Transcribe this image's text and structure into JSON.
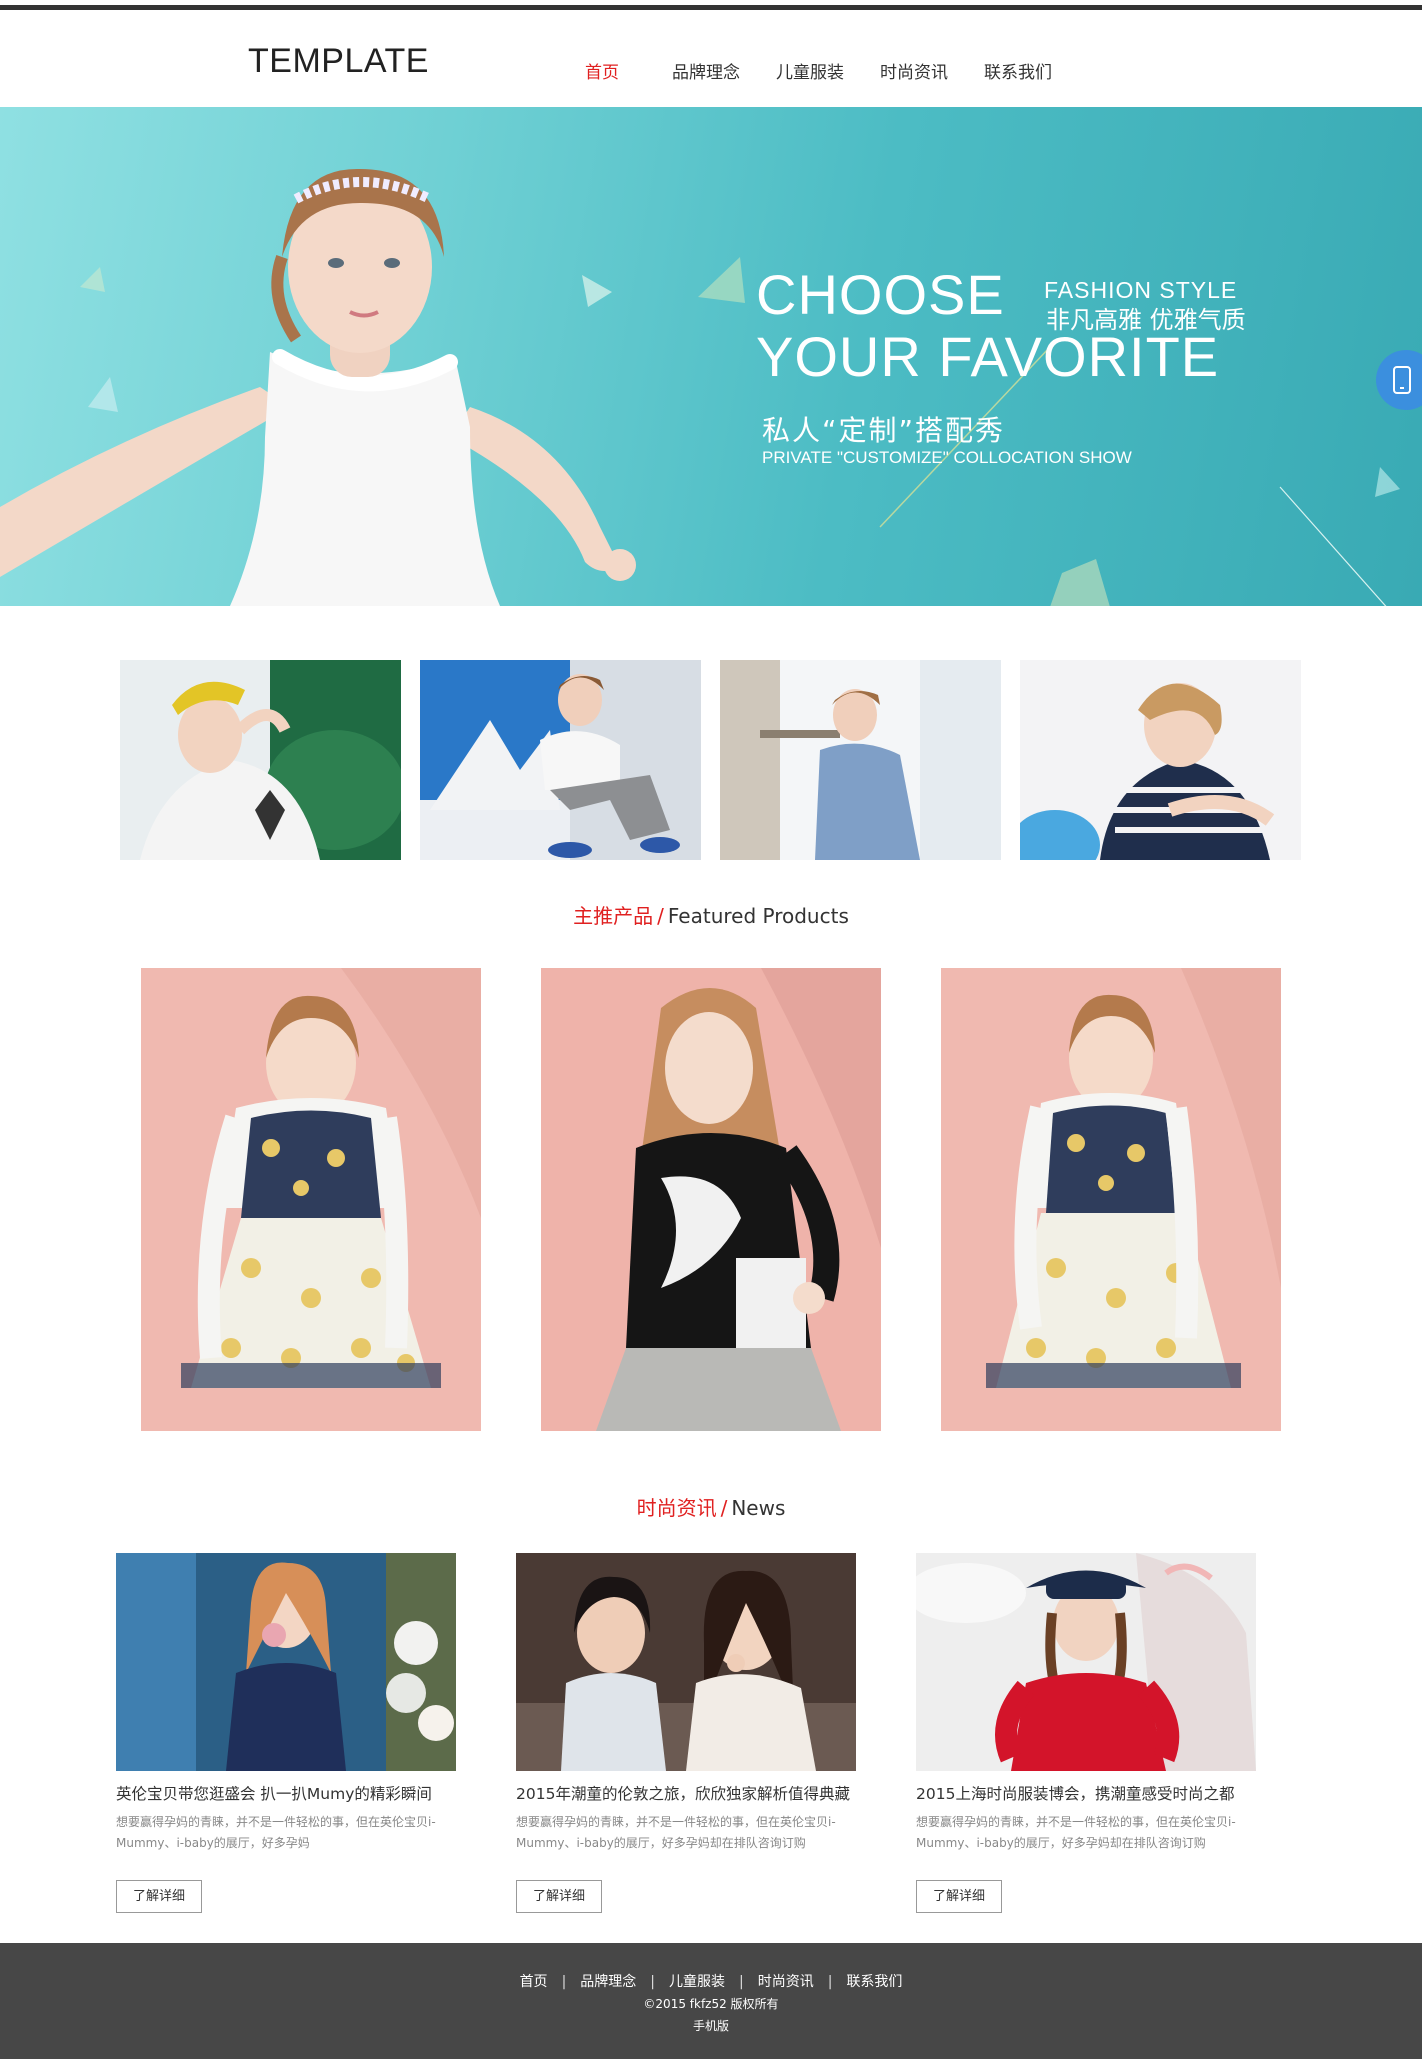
{
  "header": {
    "logo": "TEMPLATE",
    "nav": [
      {
        "label": "首页",
        "active": true
      },
      {
        "label": "品牌理念",
        "active": false
      },
      {
        "label": "儿童服装",
        "active": false
      },
      {
        "label": "时尚资讯",
        "active": false
      },
      {
        "label": "联系我们",
        "active": false
      }
    ]
  },
  "banner": {
    "line1": "CHOOSE",
    "line2": "YOUR FAVORITE",
    "fashion_style": "FASHION STYLE",
    "fashion_style_cn": "非凡高雅 优雅气质",
    "tagline_cn": "私人“定制”搭配秀",
    "tagline_en": "PRIVATE \"CUSTOMIZE\" COLLOCATION SHOW"
  },
  "side_tab": {
    "icon": "mobile-phone-icon"
  },
  "featured": {
    "title_cn": "主推产品",
    "slash": "/",
    "title_en": "Featured Products"
  },
  "news": {
    "title_cn": "时尚资讯",
    "slash": "/",
    "title_en": "News",
    "items": [
      {
        "title": "英伦宝贝带您逛盛会 扒一扒Mumy的精彩瞬间",
        "desc": "想要赢得孕妈的青睐，并不是一件轻松的事，但在英伦宝贝i-Mummy、i-baby的展厅，好多孕妈",
        "button": "了解详细"
      },
      {
        "title": "2015年潮童的伦敦之旅，欣欣独家解析值得典藏",
        "desc": "想要赢得孕妈的青睐，并不是一件轻松的事，但在英伦宝贝i-Mummy、i-baby的展厅，好多孕妈却在排队咨询订购",
        "button": "了解详细"
      },
      {
        "title": "2015上海时尚服装博会，携潮童感受时尚之都",
        "desc": "想要赢得孕妈的青睐，并不是一件轻松的事，但在英伦宝贝i-Mummy、i-baby的展厅，好多孕妈却在排队咨询订购",
        "button": "了解详细"
      }
    ]
  },
  "footer": {
    "links": [
      "首页",
      "品牌理念",
      "儿童服装",
      "时尚资讯",
      "联系我们"
    ],
    "separator": "|",
    "copyright": "©2015 fkfz52 版权所有",
    "mobile": "手机版"
  },
  "colors": {
    "accent_red": "#e02020",
    "banner_teal": "#4cbcc4",
    "product_pink": "#f0b9b0",
    "footer_bg": "#474747",
    "side_tab_blue": "#3b8fde"
  }
}
